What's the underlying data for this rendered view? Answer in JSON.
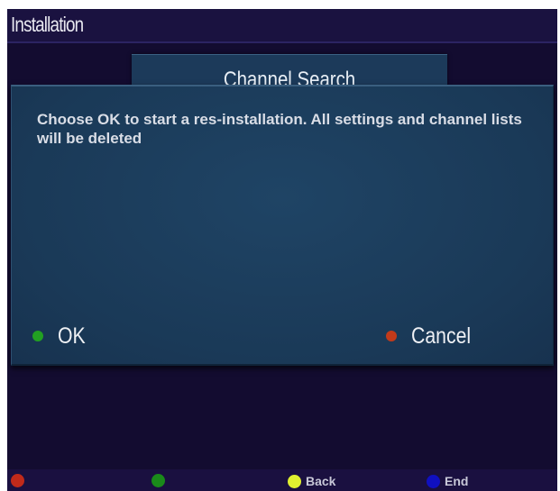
{
  "header": {
    "title": "Installation"
  },
  "background_panel": {
    "label": "Channel Search"
  },
  "dialog": {
    "message": "Choose OK to start a res-installation. All settings and channel lists will be deleted",
    "ok": {
      "label": "OK",
      "dot_color": "#22a022"
    },
    "cancel": {
      "label": "Cancel",
      "dot_color": "#c23a1a"
    }
  },
  "footer": {
    "buttons": [
      {
        "color": "#c02a1a",
        "label": ""
      },
      {
        "color": "#1a8a1a",
        "label": ""
      },
      {
        "color": "#e0f030",
        "label": "Back"
      },
      {
        "color": "#1010c0",
        "label": "End"
      }
    ]
  },
  "colors": {
    "screen_bg": "#130c30",
    "dialog_bg": "#1b3c5b",
    "text": "#e8eef5"
  }
}
